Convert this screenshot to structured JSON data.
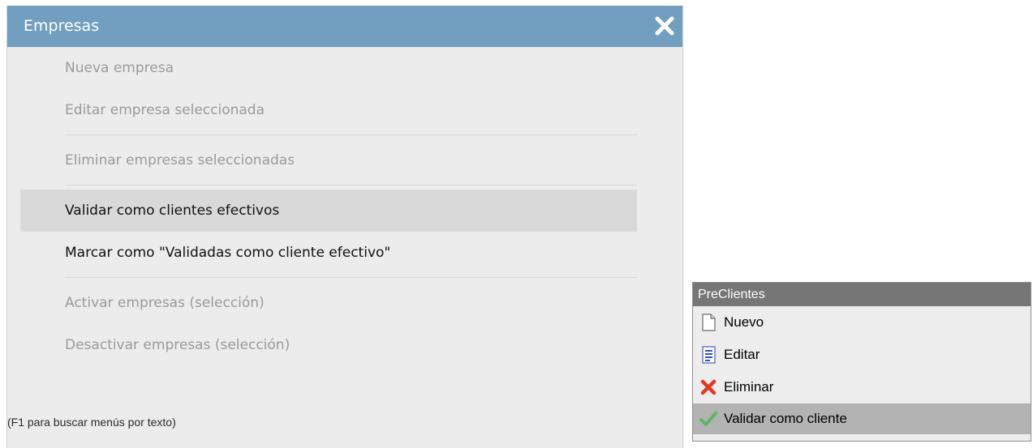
{
  "dialog": {
    "title": "Empresas",
    "menu": [
      {
        "label": "Nueva empresa"
      },
      {
        "label": "Editar empresa seleccionada"
      },
      {
        "label": "Eliminar empresas seleccionadas"
      },
      {
        "label": "Validar como clientes efectivos"
      },
      {
        "label": "Marcar como \"Validadas como cliente efectivo\""
      },
      {
        "label": "Activar empresas (selección)"
      },
      {
        "label": "Desactivar empresas (selección)"
      }
    ],
    "hint": "(F1 para buscar menús por texto)"
  },
  "context_menu": {
    "title": "PreClientes",
    "items": [
      {
        "label": "Nuevo",
        "icon": "new-document-icon"
      },
      {
        "label": "Editar",
        "icon": "edit-document-icon"
      },
      {
        "label": "Eliminar",
        "icon": "delete-x-icon"
      },
      {
        "label": "Validar como cliente",
        "icon": "checkmark-icon"
      }
    ]
  },
  "colors": {
    "dialog_header": "#729fbf",
    "context_header": "#767676",
    "disabled_text": "#9a9a9a"
  }
}
